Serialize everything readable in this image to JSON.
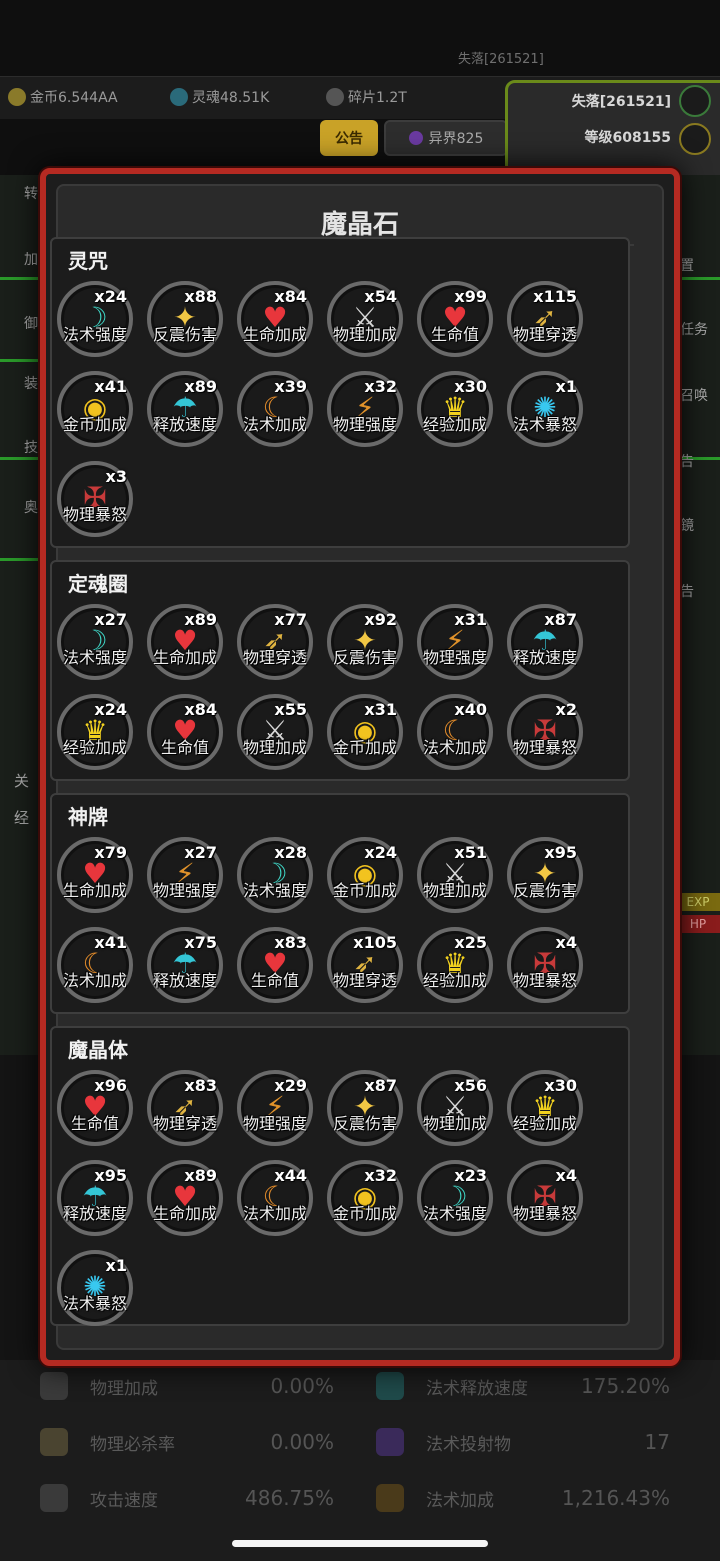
{
  "background": {
    "top_player_tag": "失落[261521]",
    "resources": [
      {
        "name": "gold-coin-icon",
        "text": "金币6.544AA",
        "color": "#c9a227"
      },
      {
        "name": "soul-icon",
        "text": "灵魂48.51K",
        "color": "#3fb6c9"
      },
      {
        "name": "shard-icon",
        "text": "碎片1.2T",
        "color": "#8a8a8a"
      }
    ],
    "announcement_tab": "公告",
    "otherworld_tab": "异界825",
    "player_name": "失落[261521]",
    "player_level": "等级608155",
    "left_fragments": [
      "转",
      "加",
      "御",
      "装",
      "技",
      "奥"
    ],
    "right_fragments": [
      "置",
      "任务",
      "召唤",
      "告",
      "鏡",
      "告"
    ],
    "left_bottom_fragments": [
      "关",
      "经"
    ],
    "exp_label": "EXP",
    "hp_label": "HP",
    "stats": [
      {
        "icon": "sword-icon",
        "label": "物理加成",
        "value": "0.00%"
      },
      {
        "icon": "cast-speed-icon",
        "label": "法术释放速度",
        "value": "175.20%"
      },
      {
        "icon": "skull-icon",
        "label": "物理必杀率",
        "value": "0.00%"
      },
      {
        "icon": "projectile-icon",
        "label": "法术投射物",
        "value": "17"
      },
      {
        "icon": "attack-speed-icon",
        "label": "攻击速度",
        "value": "486.75%"
      },
      {
        "icon": "spell-bonus-icon",
        "label": "法术加成",
        "value": "1,216.43%"
      }
    ]
  },
  "modal": {
    "title": "魔晶石",
    "sections": [
      {
        "title": "灵咒",
        "gems": [
          {
            "label": "法术强度",
            "count": "x24",
            "icon": "spell-power"
          },
          {
            "label": "反震伤害",
            "count": "x88",
            "icon": "reflect"
          },
          {
            "label": "生命加成",
            "count": "x84",
            "icon": "heart-plus"
          },
          {
            "label": "物理加成",
            "count": "x54",
            "icon": "phys-bonus"
          },
          {
            "label": "生命值",
            "count": "x99",
            "icon": "heart"
          },
          {
            "label": "物理穿透",
            "count": "x115",
            "icon": "pierce"
          },
          {
            "label": "金币加成",
            "count": "x41",
            "icon": "coins"
          },
          {
            "label": "释放速度",
            "count": "x89",
            "icon": "cast-speed"
          },
          {
            "label": "法术加成",
            "count": "x39",
            "icon": "spell-bonus"
          },
          {
            "label": "物理强度",
            "count": "x32",
            "icon": "phys-power"
          },
          {
            "label": "经验加成",
            "count": "x30",
            "icon": "crown"
          },
          {
            "label": "法术暴怒",
            "count": "x1",
            "icon": "spell-crit"
          },
          {
            "label": "物理暴怒",
            "count": "x3",
            "icon": "phys-crit"
          }
        ]
      },
      {
        "title": "定魂圈",
        "gems": [
          {
            "label": "法术强度",
            "count": "x27",
            "icon": "spell-power"
          },
          {
            "label": "生命加成",
            "count": "x89",
            "icon": "heart-plus"
          },
          {
            "label": "物理穿透",
            "count": "x77",
            "icon": "pierce"
          },
          {
            "label": "反震伤害",
            "count": "x92",
            "icon": "reflect"
          },
          {
            "label": "物理强度",
            "count": "x31",
            "icon": "phys-power"
          },
          {
            "label": "释放速度",
            "count": "x87",
            "icon": "cast-speed"
          },
          {
            "label": "经验加成",
            "count": "x24",
            "icon": "crown"
          },
          {
            "label": "生命值",
            "count": "x84",
            "icon": "heart"
          },
          {
            "label": "物理加成",
            "count": "x55",
            "icon": "phys-bonus"
          },
          {
            "label": "金币加成",
            "count": "x31",
            "icon": "coins"
          },
          {
            "label": "法术加成",
            "count": "x40",
            "icon": "spell-bonus"
          },
          {
            "label": "物理暴怒",
            "count": "x2",
            "icon": "phys-crit"
          }
        ]
      },
      {
        "title": "神牌",
        "gems": [
          {
            "label": "生命加成",
            "count": "x79",
            "icon": "heart-plus"
          },
          {
            "label": "物理强度",
            "count": "x27",
            "icon": "phys-power"
          },
          {
            "label": "法术强度",
            "count": "x28",
            "icon": "spell-power"
          },
          {
            "label": "金币加成",
            "count": "x24",
            "icon": "coins"
          },
          {
            "label": "物理加成",
            "count": "x51",
            "icon": "phys-bonus"
          },
          {
            "label": "反震伤害",
            "count": "x95",
            "icon": "reflect"
          },
          {
            "label": "法术加成",
            "count": "x41",
            "icon": "spell-bonus"
          },
          {
            "label": "释放速度",
            "count": "x75",
            "icon": "cast-speed"
          },
          {
            "label": "生命值",
            "count": "x83",
            "icon": "heart"
          },
          {
            "label": "物理穿透",
            "count": "x105",
            "icon": "pierce"
          },
          {
            "label": "经验加成",
            "count": "x25",
            "icon": "crown"
          },
          {
            "label": "物理暴怒",
            "count": "x4",
            "icon": "phys-crit"
          }
        ]
      },
      {
        "title": "魔晶体",
        "gems": [
          {
            "label": "生命值",
            "count": "x96",
            "icon": "heart"
          },
          {
            "label": "物理穿透",
            "count": "x83",
            "icon": "pierce"
          },
          {
            "label": "物理强度",
            "count": "x29",
            "icon": "phys-power"
          },
          {
            "label": "反震伤害",
            "count": "x87",
            "icon": "reflect"
          },
          {
            "label": "物理加成",
            "count": "x56",
            "icon": "phys-bonus"
          },
          {
            "label": "经验加成",
            "count": "x30",
            "icon": "crown"
          },
          {
            "label": "释放速度",
            "count": "x95",
            "icon": "cast-speed"
          },
          {
            "label": "生命加成",
            "count": "x89",
            "icon": "heart-plus"
          },
          {
            "label": "法术加成",
            "count": "x44",
            "icon": "spell-bonus"
          },
          {
            "label": "金币加成",
            "count": "x32",
            "icon": "coins"
          },
          {
            "label": "法术强度",
            "count": "x23",
            "icon": "spell-power"
          },
          {
            "label": "物理暴怒",
            "count": "x4",
            "icon": "phys-crit"
          },
          {
            "label": "法术暴怒",
            "count": "x1",
            "icon": "spell-crit"
          }
        ]
      }
    ]
  },
  "icon_styles": {
    "spell-power": {
      "glyph": "☽",
      "color": "#3fd6c6"
    },
    "reflect": {
      "glyph": "✦",
      "color": "#f2c744"
    },
    "heart-plus": {
      "glyph": "♥",
      "color": "#e8363c"
    },
    "phys-bonus": {
      "glyph": "⚔",
      "color": "#d9d9d9"
    },
    "heart": {
      "glyph": "♥",
      "color": "#e8363c"
    },
    "pierce": {
      "glyph": "➶",
      "color": "#e0b441"
    },
    "coins": {
      "glyph": "◉",
      "color": "#f2c31f"
    },
    "cast-speed": {
      "glyph": "☂",
      "color": "#34c6d6"
    },
    "spell-bonus": {
      "glyph": "☾",
      "color": "#e08a2a"
    },
    "phys-power": {
      "glyph": "⚡",
      "color": "#e0922a"
    },
    "crown": {
      "glyph": "♛",
      "color": "#f2d21f"
    },
    "spell-crit": {
      "glyph": "✺",
      "color": "#38c8f0"
    },
    "phys-crit": {
      "glyph": "✠",
      "color": "#c83a3a"
    }
  }
}
